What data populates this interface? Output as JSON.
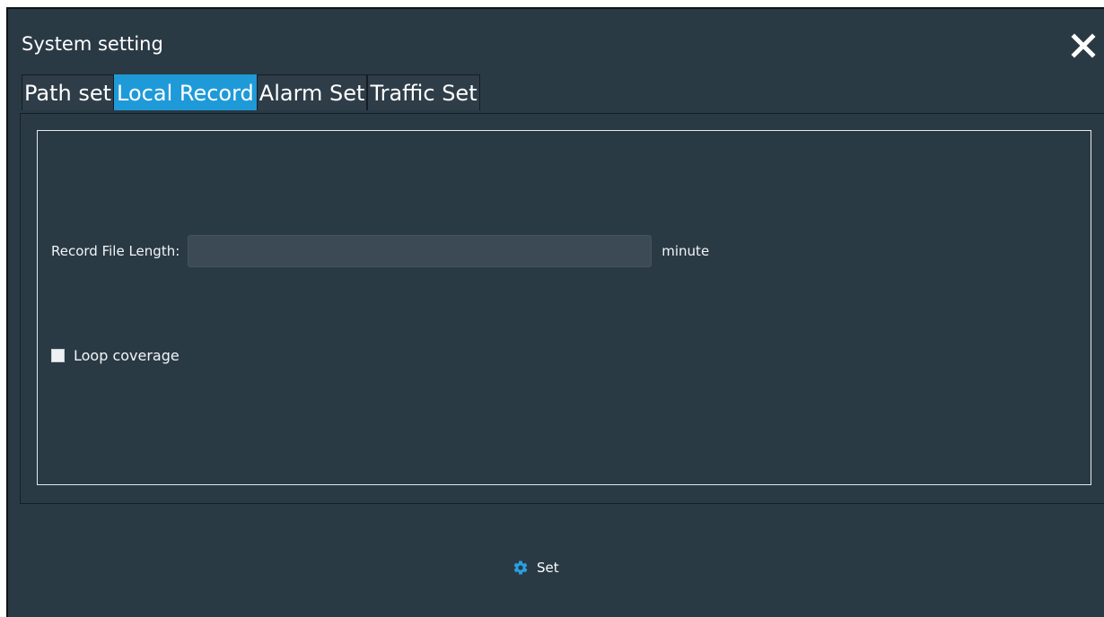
{
  "window": {
    "title": "System setting"
  },
  "tabs": [
    {
      "label": "Path set",
      "active": false
    },
    {
      "label": "Local Record",
      "active": true
    },
    {
      "label": "Alarm Set",
      "active": false
    },
    {
      "label": "Traffic Set",
      "active": false
    }
  ],
  "local_record": {
    "record_length_label": "Record File Length:",
    "record_length_value": "",
    "record_length_unit": "minute",
    "loop_coverage_label": "Loop coverage",
    "loop_coverage_checked": false
  },
  "footer": {
    "set_label": "Set",
    "set_icon": "gear-icon"
  },
  "colors": {
    "background": "#2a3a45",
    "active_tab": "#1f9ad8",
    "icon_accent": "#2a9fe0"
  }
}
